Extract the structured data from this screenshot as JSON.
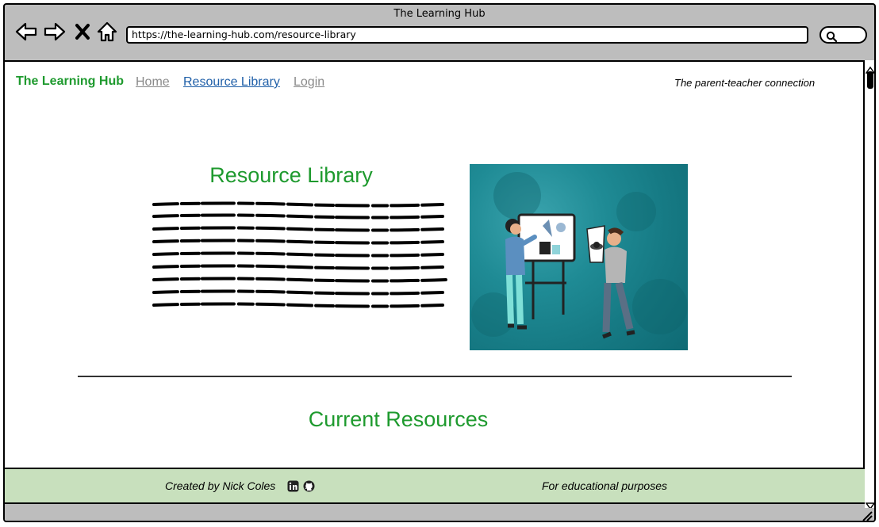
{
  "window": {
    "title": "The Learning Hub"
  },
  "browser": {
    "url": "https://the-learning-hub.com/resource-library"
  },
  "nav": {
    "brand": "The Learning Hub",
    "links": [
      {
        "label": "Home"
      },
      {
        "label": "Resource Library"
      },
      {
        "label": "Login"
      }
    ],
    "tagline": "The parent-teacher connection"
  },
  "hero": {
    "title": "Resource Library",
    "image_icon": "teachers-illustration"
  },
  "resources": {
    "title": "Current Resources"
  },
  "footer": {
    "credit": "Created by Nick Coles",
    "icons": [
      "linkedin-icon",
      "github-icon"
    ],
    "note": "For educational purposes"
  },
  "colors": {
    "brand_green": "#1e9a2e",
    "active_link": "#1f5fa8",
    "inactive_link": "#8a8a8a",
    "footer_bg": "#c8e0bd",
    "image_bg": "#1f8b95"
  }
}
